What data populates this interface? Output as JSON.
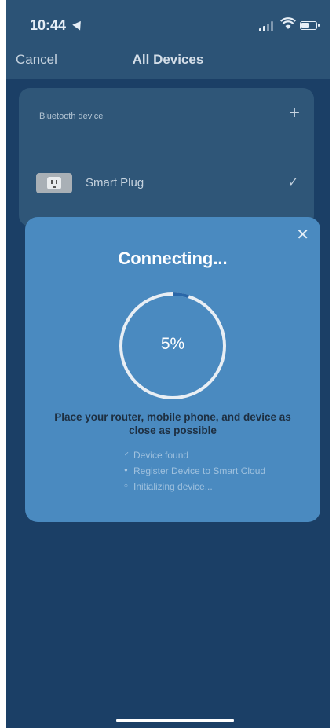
{
  "status_bar": {
    "time": "10:44"
  },
  "nav": {
    "cancel_label": "Cancel",
    "title": "All Devices"
  },
  "device_card": {
    "header": "Bluetooth device",
    "plus_label": "+",
    "device_name": "Smart Plug",
    "check_label": "✓"
  },
  "modal": {
    "close_label": "✕",
    "title": "Connecting...",
    "progress_percent": 5,
    "progress_label": "5%",
    "instruction": "Place your router, mobile phone, and device as close as possible",
    "steps": [
      {
        "label": "Device found",
        "mark": "✓"
      },
      {
        "label": "Register Device to Smart Cloud",
        "mark": "●"
      },
      {
        "label": "Initializing device...",
        "mark": "○"
      }
    ]
  },
  "colors": {
    "background": "#1b3f66",
    "nav_bar": "#2c5376",
    "modal": "#4a8ac0",
    "progress": "#2a67a8",
    "ring_track": "#e8eef4"
  }
}
